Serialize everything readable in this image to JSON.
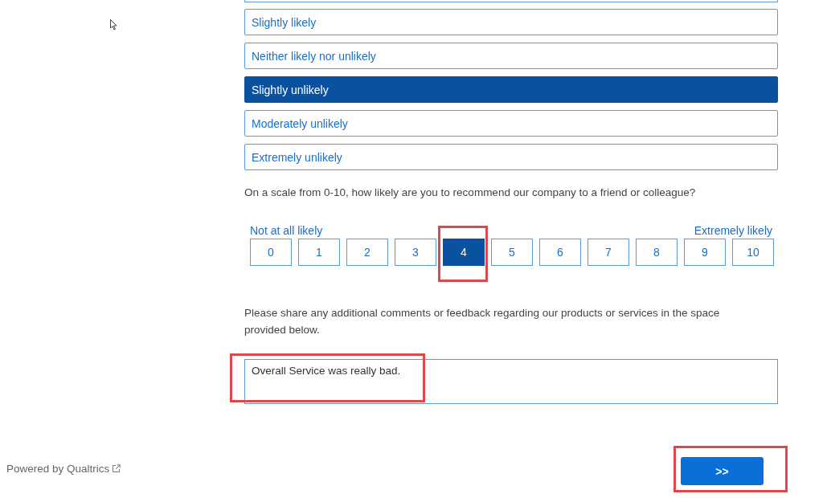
{
  "choices": [
    {
      "label": "Slightly likely",
      "selected": false
    },
    {
      "label": "Neither likely nor unlikely",
      "selected": false
    },
    {
      "label": "Slightly unlikely",
      "selected": true
    },
    {
      "label": "Moderately unlikely",
      "selected": false
    },
    {
      "label": "Extremely unlikely",
      "selected": false
    }
  ],
  "nps": {
    "question": "On a scale from 0-10, how likely are you to recommend our company to a friend or colleague?",
    "low_label": "Not at all likely",
    "high_label": "Extremely likely",
    "options": [
      {
        "label": "0",
        "selected": false,
        "highlighted": false
      },
      {
        "label": "1",
        "selected": false,
        "highlighted": false
      },
      {
        "label": "2",
        "selected": false,
        "highlighted": false
      },
      {
        "label": "3",
        "selected": false,
        "highlighted": false
      },
      {
        "label": "4",
        "selected": true,
        "highlighted": true
      },
      {
        "label": "5",
        "selected": false,
        "highlighted": false
      },
      {
        "label": "6",
        "selected": false,
        "highlighted": false
      },
      {
        "label": "7",
        "selected": false,
        "highlighted": false
      },
      {
        "label": "8",
        "selected": false,
        "highlighted": false
      },
      {
        "label": "9",
        "selected": false,
        "highlighted": false
      },
      {
        "label": "10",
        "selected": false,
        "highlighted": false
      }
    ]
  },
  "comments": {
    "question": "Please share any additional comments or feedback regarding our products or services in the space provided below.",
    "value": "Overall Service was really bad.",
    "highlighted": true
  },
  "footer": {
    "powered_by": "Powered by Qualtrics"
  },
  "next_button": {
    "label": ">>",
    "highlighted": true
  }
}
